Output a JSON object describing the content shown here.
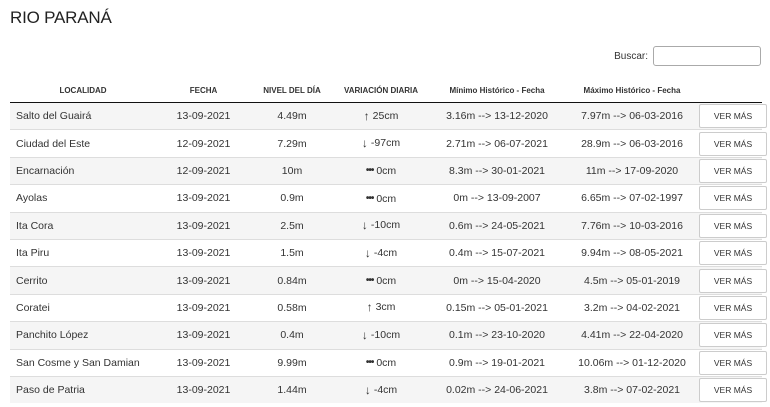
{
  "title": "RIO PARANÁ",
  "search": {
    "label": "Buscar:",
    "value": ""
  },
  "columns": [
    "LOCALIDAD",
    "FECHA",
    "NIVEL DEL DÍA",
    "VARIACIÓN DIARIA",
    "Mínimo Histórico - Fecha",
    "Máximo Histórico - Fecha",
    ""
  ],
  "rows": [
    {
      "localidad": "Salto del Guairá",
      "fecha": "13-09-2021",
      "nivel": "4.49m",
      "variacion": "25cm",
      "trend_icon": "arrow-up",
      "minimo": "3.16m --> 13-12-2020",
      "maximo": "7.97m --> 06-03-2016",
      "boton": "VER MÁS"
    },
    {
      "localidad": "Ciudad del Este",
      "fecha": "12-09-2021",
      "nivel": "7.29m",
      "variacion": "-97cm",
      "trend_icon": "arrow-down",
      "minimo": "2.71m --> 06-07-2021",
      "maximo": "28.9m --> 06-03-2016",
      "boton": "VER MÁS"
    },
    {
      "localidad": "Encarnación",
      "fecha": "12-09-2021",
      "nivel": "10m",
      "variacion": "0cm",
      "trend_icon": "dots",
      "minimo": "8.3m --> 30-01-2021",
      "maximo": "11m --> 17-09-2020",
      "boton": "VER MÁS"
    },
    {
      "localidad": "Ayolas",
      "fecha": "13-09-2021",
      "nivel": "0.9m",
      "variacion": "0cm",
      "trend_icon": "dots",
      "minimo": "0m --> 13-09-2007",
      "maximo": "6.65m --> 07-02-1997",
      "boton": "VER MÁS"
    },
    {
      "localidad": "Ita Cora",
      "fecha": "13-09-2021",
      "nivel": "2.5m",
      "variacion": "-10cm",
      "trend_icon": "arrow-down",
      "minimo": "0.6m --> 24-05-2021",
      "maximo": "7.76m --> 10-03-2016",
      "boton": "VER MÁS"
    },
    {
      "localidad": "Ita Piru",
      "fecha": "13-09-2021",
      "nivel": "1.5m",
      "variacion": "-4cm",
      "trend_icon": "arrow-down",
      "minimo": "0.4m --> 15-07-2021",
      "maximo": "9.94m --> 08-05-2021",
      "boton": "VER MÁS"
    },
    {
      "localidad": "Cerrito",
      "fecha": "13-09-2021",
      "nivel": "0.84m",
      "variacion": "0cm",
      "trend_icon": "dots",
      "minimo": "0m --> 15-04-2020",
      "maximo": "4.5m --> 05-01-2019",
      "boton": "VER MÁS"
    },
    {
      "localidad": "Coratei",
      "fecha": "13-09-2021",
      "nivel": "0.58m",
      "variacion": "3cm",
      "trend_icon": "arrow-up",
      "minimo": "0.15m --> 05-01-2021",
      "maximo": "3.2m --> 04-02-2021",
      "boton": "VER MÁS"
    },
    {
      "localidad": "Panchito López",
      "fecha": "13-09-2021",
      "nivel": "0.4m",
      "variacion": "-10cm",
      "trend_icon": "arrow-down",
      "minimo": "0.1m --> 23-10-2020",
      "maximo": "4.41m --> 22-04-2020",
      "boton": "VER MÁS"
    },
    {
      "localidad": "San Cosme y San Damian",
      "fecha": "13-09-2021",
      "nivel": "9.99m",
      "variacion": "0cm",
      "trend_icon": "dots",
      "minimo": "0.9m --> 19-01-2021",
      "maximo": "10.06m --> 01-12-2020",
      "boton": "VER MÁS"
    },
    {
      "localidad": "Paso de Patria",
      "fecha": "13-09-2021",
      "nivel": "1.44m",
      "variacion": "-4cm",
      "trend_icon": "arrow-down",
      "minimo": "0.02m --> 24-06-2021",
      "maximo": "3.8m --> 07-02-2021",
      "boton": "VER MÁS"
    }
  ]
}
